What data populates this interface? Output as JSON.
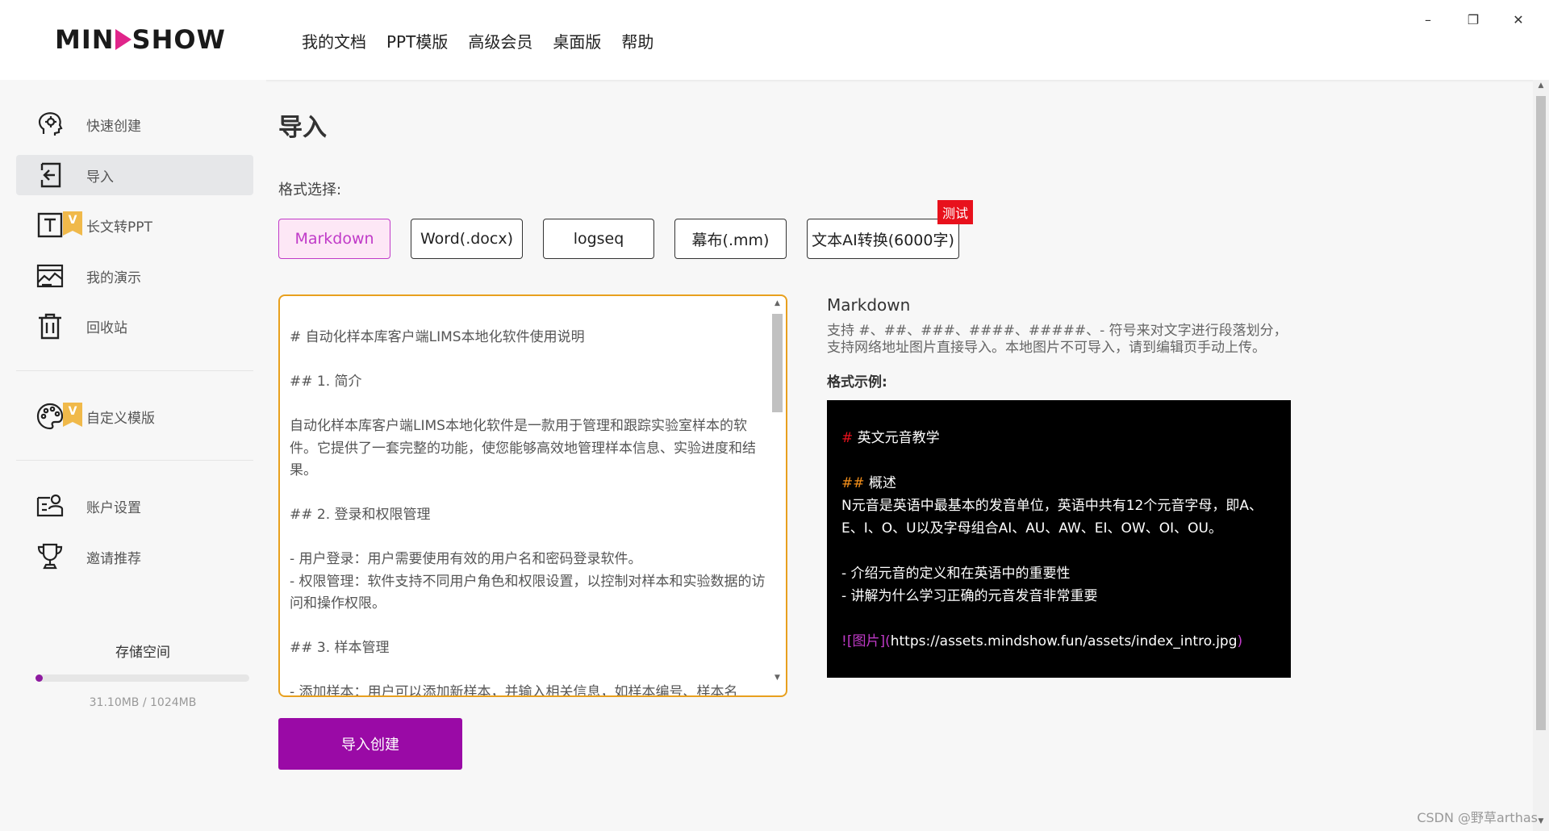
{
  "app": {
    "logo_left": "MIN",
    "logo_right": "SHOW"
  },
  "topnav": [
    "我的文档",
    "PPT模版",
    "高级会员",
    "桌面版",
    "帮助"
  ],
  "window_controls": {
    "minimize": "–",
    "restore": "❐",
    "close": "✕"
  },
  "sidebar": {
    "items": [
      {
        "label": "快速创建",
        "icon": "lightbulb-head-icon"
      },
      {
        "label": "导入",
        "icon": "import-icon",
        "active": true
      },
      {
        "label": "长文转PPT",
        "icon": "text-icon",
        "badge": "V"
      },
      {
        "label": "我的演示",
        "icon": "presentation-icon"
      },
      {
        "label": "回收站",
        "icon": "trash-icon"
      },
      {
        "label": "自定义模版",
        "icon": "palette-icon",
        "badge": "V"
      },
      {
        "label": "账户设置",
        "icon": "account-icon"
      },
      {
        "label": "邀请推荐",
        "icon": "trophy-icon"
      }
    ],
    "storage": {
      "title": "存储空间",
      "text": "31.10MB / 1024MB",
      "used_fraction": 0.0304
    }
  },
  "main": {
    "title": "导入",
    "format_label": "格式选择:",
    "formats": [
      "Markdown",
      "Word(.docx)",
      "logseq",
      "幕布(.mm)",
      "文本AI转换(6000字)"
    ],
    "active_format": "Markdown",
    "beta_badge": "测试",
    "editor_lines": [
      "# 自动化样本库客户端LIMS本地化软件使用说明",
      "",
      "## 1. 简介",
      "",
      "自动化样本库客户端LIMS本地化软件是一款用于管理和跟踪实验室样本的软件。它提供了一套完整的功能，使您能够高效地管理样本信息、实验进度和结果。",
      "",
      "## 2. 登录和权限管理",
      "",
      "- 用户登录：用户需要使用有效的用户名和密码登录软件。",
      "- 权限管理：软件支持不同用户角色和权限设置，以控制对样本和实验数据的访问和操作权限。",
      "",
      "## 3. 样本管理",
      "",
      "- 添加样本：用户可以添加新样本，并输入相关信息，如样本编号、样本名"
    ],
    "create_button": "导入创建",
    "info": {
      "title": "Markdown",
      "desc": "支持 #、##、###、####、#####、- 符号来对文字进行段落划分，支持网络地址图片直接导入。本地图片不可导入，请到编辑页手动上传。",
      "example_title": "格式示例:",
      "example": {
        "l1_mark": "#",
        "l1_text": " 英文元音教学",
        "l2_mark": "##",
        "l2_text": " 概述",
        "l3": " N元音是英语中最基本的发音单位，英语中共有12个元音字母，即A、E、I、O、U以及字母组合AI、AU、AW、EI、OW、OI、OU。",
        "l4": "- 介绍元音的定义和在英语中的重要性",
        "l5": "- 讲解为什么学习正确的元音发音非常重要",
        "l6_mark": "![图片](",
        "l6_url": "https://assets.mindshow.fun/assets/index_intro.jpg",
        "l6_end": ")"
      }
    }
  },
  "watermark": "CSDN @野草arthas"
}
